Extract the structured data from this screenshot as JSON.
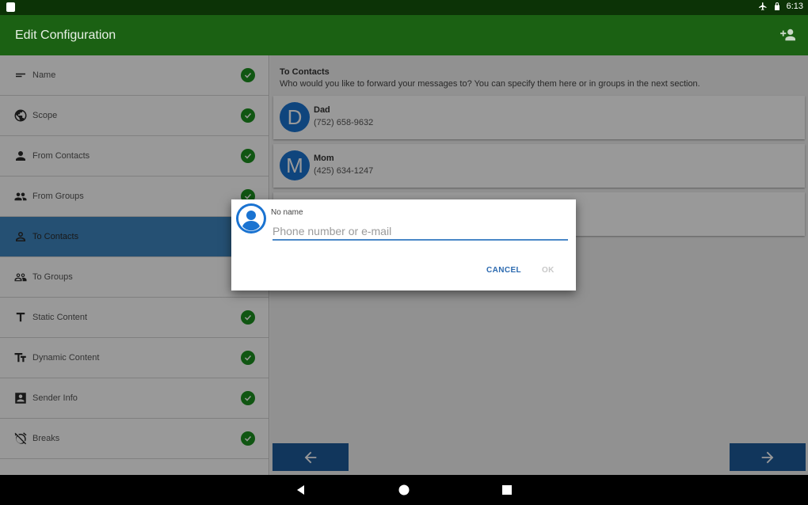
{
  "status_bar": {
    "time": "6:13"
  },
  "app_bar": {
    "title": "Edit Configuration"
  },
  "sidebar": {
    "items": [
      {
        "label": "Name",
        "icon": "short-text-icon",
        "checked": true
      },
      {
        "label": "Scope",
        "icon": "globe-icon",
        "checked": true
      },
      {
        "label": "From Contacts",
        "icon": "person-icon",
        "checked": true
      },
      {
        "label": "From Groups",
        "icon": "people-icon",
        "checked": true
      },
      {
        "label": "To Contacts",
        "icon": "person-outline-icon",
        "checked": true,
        "active": true
      },
      {
        "label": "To Groups",
        "icon": "people-outline-icon",
        "checked": false
      },
      {
        "label": "Static Content",
        "icon": "text-t-icon",
        "checked": true
      },
      {
        "label": "Dynamic Content",
        "icon": "text-size-icon",
        "checked": true
      },
      {
        "label": "Sender Info",
        "icon": "contact-card-icon",
        "checked": true
      },
      {
        "label": "Breaks",
        "icon": "alarm-off-icon",
        "checked": true
      }
    ]
  },
  "main": {
    "section_title": "To Contacts",
    "section_desc": "Who would you like to forward your messages to? You can specify them here or in groups in the next section.",
    "contacts": [
      {
        "initial": "D",
        "name": "Dad",
        "phone": "(752) 658-9632"
      },
      {
        "initial": "M",
        "name": "Mom",
        "phone": "(425) 634-1247"
      }
    ]
  },
  "dialog": {
    "name": "No name",
    "placeholder": "Phone number or e-mail",
    "cancel_label": "CANCEL",
    "ok_label": "OK"
  },
  "colors": {
    "status_bar": "#0c3306",
    "app_bar": "#1b6113",
    "active_item": "#3f86c0",
    "check": "#1b8f1f",
    "avatar": "#1a73d1",
    "nav_button": "#1d5a9a"
  }
}
